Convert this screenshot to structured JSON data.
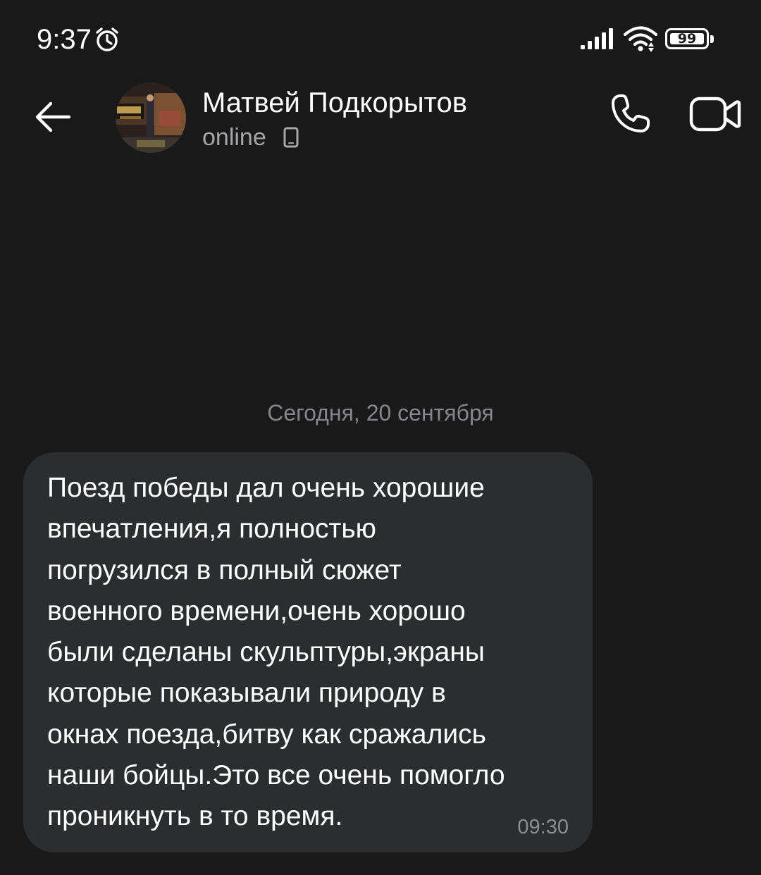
{
  "status_bar": {
    "time": "9:37",
    "battery_level": "99",
    "icons": [
      "alarm-icon",
      "signal-icon",
      "wifi-icon",
      "battery-icon"
    ]
  },
  "header": {
    "back_icon": "arrow-left-icon",
    "contact_name": "Матвей Подкорытов",
    "contact_status": "online",
    "status_device_icon": "mobile-phone-icon",
    "call_icon": "phone-icon",
    "video_icon": "video-camera-icon"
  },
  "chat": {
    "date_separator": "Сегодня, 20 сентября",
    "messages": [
      {
        "text": "Поезд победы дал очень хорошие\nвпечатления,я полностью\nпогрузился в полный сюжет\nвоенного времени,очень хорошо\nбыли сделаны скульптуры,экраны\nкоторые показывали природу в\nокнах поезда,битву как сражались\nнаши бойцы.Это все очень помогло\nпроникнуть в то время.",
        "time": "09:30"
      }
    ]
  },
  "colors": {
    "background": "#19191a",
    "bubble": "#2c2d2f",
    "secondary_text": "#a6a6a8",
    "muted_text": "#86868a"
  }
}
